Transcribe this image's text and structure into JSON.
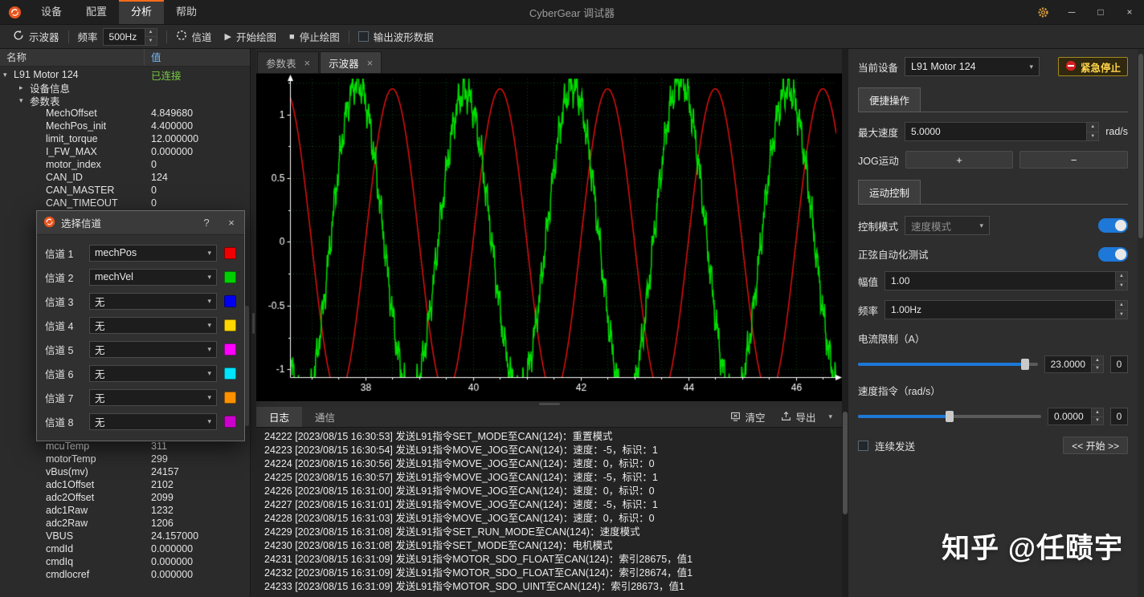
{
  "window": {
    "title": "CyberGear 调试器",
    "minimize": "─",
    "maximize": "□",
    "close": "×"
  },
  "menubar": {
    "items": [
      {
        "label": "设备",
        "cls": ""
      },
      {
        "label": "配置",
        "cls": ""
      },
      {
        "label": "分析",
        "cls": "active"
      },
      {
        "label": "帮助",
        "cls": ""
      }
    ]
  },
  "toolbar": {
    "scope": "示波器",
    "freq_label": "频率",
    "freq_value": "500Hz",
    "channel": "信道",
    "start_plot": "开始绘图",
    "stop_plot": "停止绘图",
    "output_wave": "输出波形数据",
    "start_icon": "▶",
    "stop_icon": "■"
  },
  "tree": {
    "col_name": "名称",
    "col_value": "值",
    "rows_top": [
      {
        "label": "L91 Motor 124",
        "value": "已连接",
        "lv": "lv0",
        "exp": "open",
        "vc": "ok"
      },
      {
        "label": "设备信息",
        "value": "",
        "lv": "lv1",
        "exp": "closed",
        "vc": ""
      },
      {
        "label": "参数表",
        "value": "",
        "lv": "lv1",
        "exp": "open",
        "vc": ""
      },
      {
        "label": "MechOffset",
        "value": "4.849680",
        "lv": "lv2",
        "exp": "leaf",
        "vc": ""
      },
      {
        "label": "MechPos_init",
        "value": "4.400000",
        "lv": "lv2",
        "exp": "leaf",
        "vc": ""
      },
      {
        "label": "limit_torque",
        "value": "12.000000",
        "lv": "lv2",
        "exp": "leaf",
        "vc": ""
      },
      {
        "label": "I_FW_MAX",
        "value": "0.000000",
        "lv": "lv2",
        "exp": "leaf",
        "vc": ""
      },
      {
        "label": "motor_index",
        "value": "0",
        "lv": "lv2",
        "exp": "leaf",
        "vc": ""
      },
      {
        "label": "CAN_ID",
        "value": "124",
        "lv": "lv2",
        "exp": "leaf",
        "vc": ""
      },
      {
        "label": "CAN_MASTER",
        "value": "0",
        "lv": "lv2",
        "exp": "leaf",
        "vc": ""
      },
      {
        "label": "CAN_TIMEOUT",
        "value": "0",
        "lv": "lv2",
        "exp": "leaf",
        "vc": ""
      }
    ],
    "rows_bottom": [
      {
        "label": "mcuTemp",
        "value": "311",
        "lv": "lv2",
        "exp": "leaf",
        "vc": ""
      },
      {
        "label": "motorTemp",
        "value": "299",
        "lv": "lv2",
        "exp": "leaf",
        "vc": ""
      },
      {
        "label": "vBus(mv)",
        "value": "24157",
        "lv": "lv2",
        "exp": "leaf",
        "vc": ""
      },
      {
        "label": "adc1Offset",
        "value": "2102",
        "lv": "lv2",
        "exp": "leaf",
        "vc": ""
      },
      {
        "label": "adc2Offset",
        "value": "2099",
        "lv": "lv2",
        "exp": "leaf",
        "vc": ""
      },
      {
        "label": "adc1Raw",
        "value": "1232",
        "lv": "lv2",
        "exp": "leaf",
        "vc": ""
      },
      {
        "label": "adc2Raw",
        "value": "1206",
        "lv": "lv2",
        "exp": "leaf",
        "vc": ""
      },
      {
        "label": "VBUS",
        "value": "24.157000",
        "lv": "lv2",
        "exp": "leaf",
        "vc": ""
      },
      {
        "label": "cmdId",
        "value": "0.000000",
        "lv": "lv2",
        "exp": "leaf",
        "vc": ""
      },
      {
        "label": "cmdIq",
        "value": "0.000000",
        "lv": "lv2",
        "exp": "leaf",
        "vc": ""
      },
      {
        "label": "cmdlocref",
        "value": "0.000000",
        "lv": "lv2",
        "exp": "leaf",
        "vc": ""
      }
    ]
  },
  "dialog": {
    "title": "选择信道",
    "help": "?",
    "close": "×",
    "channels": [
      {
        "label": "信道 1",
        "value": "mechPos",
        "color": "#f00000"
      },
      {
        "label": "信道 2",
        "value": "mechVel",
        "color": "#00d000"
      },
      {
        "label": "信道 3",
        "value": "无",
        "color": "#0000f0"
      },
      {
        "label": "信道 4",
        "value": "无",
        "color": "#ffd800"
      },
      {
        "label": "信道 5",
        "value": "无",
        "color": "#ff00ff"
      },
      {
        "label": "信道 6",
        "value": "无",
        "color": "#00e5ff"
      },
      {
        "label": "信道 7",
        "value": "无",
        "color": "#ff9100"
      },
      {
        "label": "信道 8",
        "value": "无",
        "color": "#cc00cc"
      }
    ]
  },
  "center": {
    "tabs": [
      {
        "label": "参数表",
        "cls": ""
      },
      {
        "label": "示波器",
        "cls": "active"
      }
    ]
  },
  "log": {
    "tabs": [
      {
        "label": "日志",
        "cls": "active"
      },
      {
        "label": "通信",
        "cls": ""
      }
    ],
    "clear": "清空",
    "export": "导出",
    "lines": [
      "24222 [2023/08/15 16:30:53] 发送L91指令SET_MODE至CAN(124)：重置模式",
      "24223 [2023/08/15 16:30:54] 发送L91指令MOVE_JOG至CAN(124)：速度：-5，标识：1",
      "24224 [2023/08/15 16:30:56] 发送L91指令MOVE_JOG至CAN(124)：速度：0，标识：0",
      "24225 [2023/08/15 16:30:57] 发送L91指令MOVE_JOG至CAN(124)：速度：-5，标识：1",
      "24226 [2023/08/15 16:31:00] 发送L91指令MOVE_JOG至CAN(124)：速度：0，标识：0",
      "24227 [2023/08/15 16:31:01] 发送L91指令MOVE_JOG至CAN(124)：速度：-5，标识：1",
      "24228 [2023/08/15 16:31:03] 发送L91指令MOVE_JOG至CAN(124)：速度：0，标识：0",
      "24229 [2023/08/15 16:31:08] 发送L91指令SET_RUN_MODE至CAN(124)：速度模式",
      "24230 [2023/08/15 16:31:08] 发送L91指令SET_MODE至CAN(124)：电机模式",
      "24231 [2023/08/15 16:31:09] 发送L91指令MOTOR_SDO_FLOAT至CAN(124)：索引28675，值1",
      "24232 [2023/08/15 16:31:09] 发送L91指令MOTOR_SDO_FLOAT至CAN(124)：索引28674，值1",
      "24233 [2023/08/15 16:31:09] 发送L91指令MOTOR_SDO_UINT至CAN(124)：索引28673，值1"
    ]
  },
  "right": {
    "device_label": "当前设备",
    "device_value": "L91 Motor 124",
    "estop_label": "紧急停止",
    "quick_tab": "便捷操作",
    "max_speed_label": "最大速度",
    "max_speed_value": "5.0000",
    "max_speed_unit": "rad/s",
    "jog_label": "JOG运动",
    "jog_plus": "+",
    "jog_minus": "−",
    "motion_tab": "运动控制",
    "ctrl_mode_label": "控制模式",
    "ctrl_mode_value": "速度模式",
    "sine_test_label": "正弦自动化测试",
    "amp_label": "幅值",
    "amp_value": "1.00",
    "freq_label": "频率",
    "freq_value": "1.00Hz",
    "current_limit_label": "电流限制（A）",
    "current_limit_value": "23.0000",
    "current_limit_aux": "0",
    "current_limit_fill": "93%",
    "speed_cmd_label": "速度指令（rad/s）",
    "speed_cmd_value": "0.0000",
    "speed_cmd_aux": "0",
    "speed_cmd_fill": "50%",
    "continuous_label": "连续发送",
    "start_button": "<< 开始 >>"
  },
  "watermark": "知乎 @任赜宇",
  "chart_data": {
    "type": "line",
    "title": "",
    "xlabel": "",
    "ylabel": "",
    "x_range": [
      36.6,
      46.75
    ],
    "y_range": [
      -1.06,
      1.28
    ],
    "x_ticks": [
      38,
      40,
      42,
      44,
      46
    ],
    "y_ticks": [
      1,
      0.5,
      0,
      -0.5,
      -1
    ],
    "grid": {
      "x_step": 0.5,
      "y_step": 0.25,
      "color": "#0c4a14"
    },
    "axis_color": "#ffffff",
    "background": "#000000",
    "series": [
      {
        "name": "mechPos",
        "color": "#e01010",
        "amplitude": 1.2,
        "period": 2.0,
        "peak_x": 38.5,
        "noise": 0
      },
      {
        "name": "mechVel",
        "color": "#00dd00",
        "amplitude": 1.22,
        "period": 2.0,
        "peak_x": 37.85,
        "noise": 0.15
      }
    ]
  }
}
